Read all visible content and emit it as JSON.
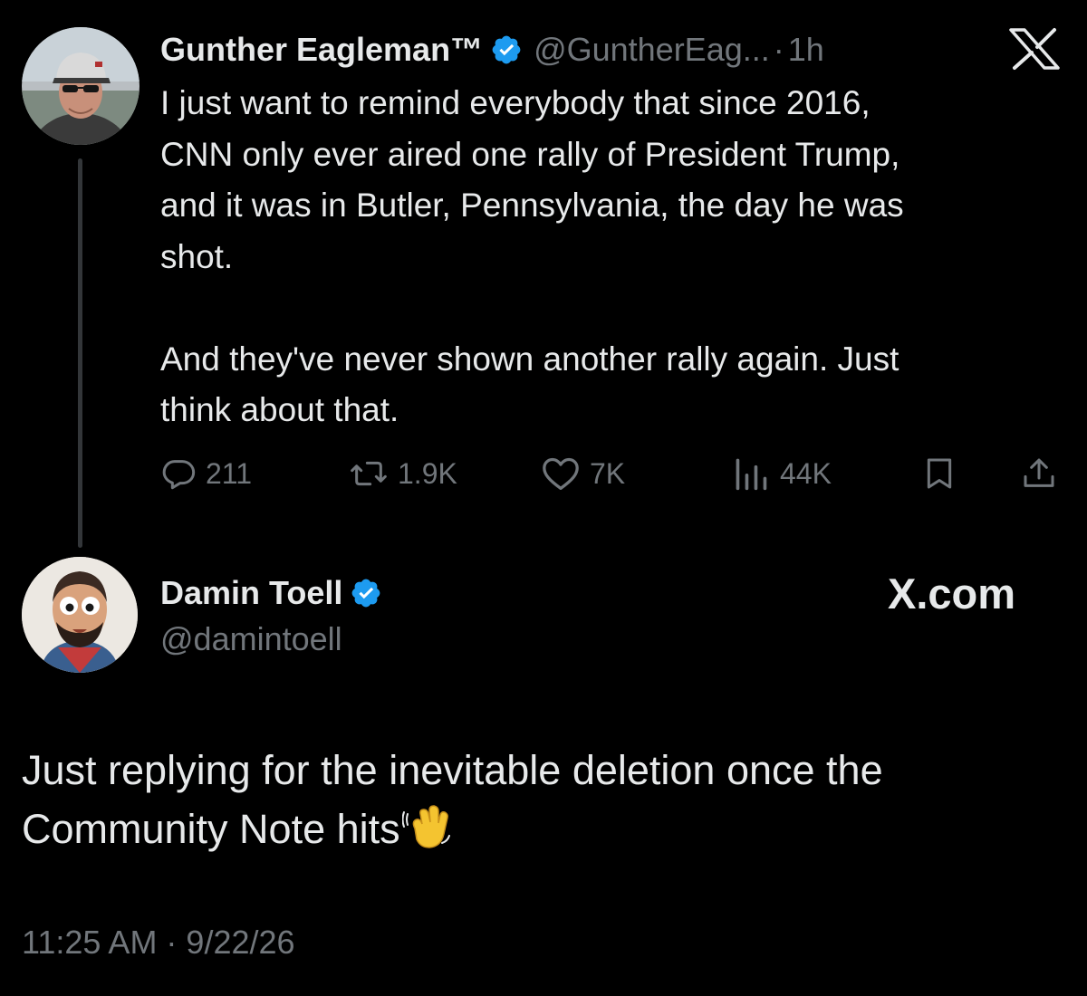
{
  "parent_tweet": {
    "author_name": "Gunther Eagleman™",
    "handle": "@GuntherEag...",
    "separator": "·",
    "time": "1h",
    "verified": true,
    "body_lines": [
      "I just want to remind everybody that since 2016,",
      "CNN only ever aired one rally of President Trump,",
      "and it was in Butler, Pennsylvania, the day he was",
      "shot."
    ],
    "body_lines_2": [
      "And they've never shown another rally again. Just",
      "think about that."
    ],
    "actions": {
      "replies": "211",
      "reposts": "1.9K",
      "likes": "7K",
      "views": "44K"
    },
    "icons": [
      "reply-icon",
      "repost-icon",
      "like-icon",
      "views-icon",
      "bookmark-icon",
      "share-icon",
      "x-logo-icon",
      "verified-badge-icon"
    ]
  },
  "reply_tweet": {
    "author_name": "Damin Toell",
    "handle": "@damintoell",
    "verified": true,
    "brand": "X.com",
    "body_line_1": "Just replying for the inevitable deletion once the",
    "body_line_2": "Community Note hits",
    "emoji": "waving-hand-icon",
    "timestamp": "11:25 AM · 9/22/26"
  },
  "colors": {
    "background": "#000000",
    "primary_text": "#e7e9ea",
    "secondary_text": "#71767b",
    "verified_blue": "#1d9bf0",
    "thread_line": "#333639"
  }
}
